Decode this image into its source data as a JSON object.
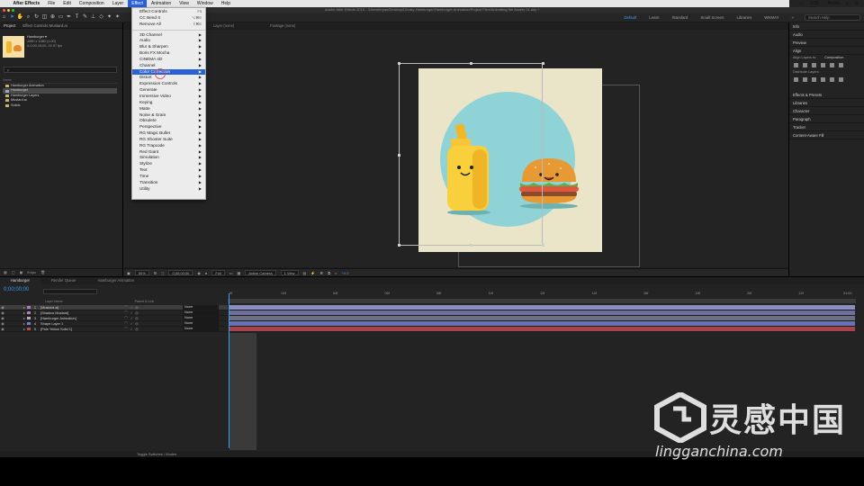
{
  "macbar": {
    "app": "After Effects",
    "menus": [
      "File",
      "Edit",
      "Composition",
      "Layer",
      "Effect",
      "Animation",
      "View",
      "Window",
      "Help"
    ],
    "active_menu": "Effect",
    "clock": "Tue 3:56 PM",
    "user": "Bryan"
  },
  "window": {
    "title": "Adobe After Effects 2019 - /Users/bryan/Desktop/Library-Hamburger/Hamburger Animation/Project Files/Animating the Assets 01.aep *"
  },
  "workspaces": {
    "items": [
      "Default",
      "Learn",
      "Standard",
      "Small Screen",
      "Libraries",
      "WKMAY"
    ],
    "active": "Default",
    "search_placeholder": "Search Help"
  },
  "project_panel": {
    "tabs": [
      "Project",
      "Effect Controls Mustard.ai"
    ],
    "item_name": "Hamburger ▾",
    "item_info_1": "1080 x 1080 (1.00)",
    "item_info_2": "Δ 0;00;15;00, 29.97 fps",
    "search_placeholder": "ρ",
    "column_name": "Name",
    "items": [
      {
        "name": "Hamburger Animation",
        "color": "#c9b36b"
      },
      {
        "name": "Hamburger",
        "color": "#9aa5c9"
      },
      {
        "name": "Hamburger Layers",
        "color": "#c9b36b"
      },
      {
        "name": "Mustard.ai",
        "color": "#c9b36b"
      },
      {
        "name": "Solids",
        "color": "#c9b36b"
      }
    ],
    "bpc": "8 bpc"
  },
  "comp_tabs": [
    "Layer (none)",
    "Footage (none)"
  ],
  "comp_footer": {
    "zoom": "50%",
    "timecode": "0;00;00;00",
    "resolution": "Full",
    "camera": "Active Camera",
    "views": "1 View",
    "exposure": "+0.0"
  },
  "effect_menu": {
    "items": [
      {
        "label": "Effect Controls",
        "shortcut": "F3"
      },
      {
        "label": "CC Bend It",
        "shortcut": "⌥⌘E"
      },
      {
        "label": "Remove All",
        "shortcut": "⇧⌘E"
      },
      {
        "sep": true
      },
      {
        "label": "3D Channel",
        "sub": true
      },
      {
        "label": "Audio",
        "sub": true
      },
      {
        "label": "Blur & Sharpen",
        "sub": true
      },
      {
        "label": "Boris FX Mocha",
        "sub": true
      },
      {
        "label": "CINEMA 4D",
        "sub": true
      },
      {
        "label": "Channel",
        "sub": true
      },
      {
        "label": "Color Correction",
        "sub": true,
        "hl": true
      },
      {
        "label": "Distort",
        "sub": true
      },
      {
        "label": "Expression Controls",
        "sub": true
      },
      {
        "label": "Generate",
        "sub": true
      },
      {
        "label": "Immersive Video",
        "sub": true
      },
      {
        "label": "Keying",
        "sub": true
      },
      {
        "label": "Matte",
        "sub": true
      },
      {
        "label": "Noise & Grain",
        "sub": true
      },
      {
        "label": "Obsolete",
        "sub": true
      },
      {
        "label": "Perspective",
        "sub": true
      },
      {
        "label": "RG Magic Bullet",
        "sub": true
      },
      {
        "label": "RG Shooter Suite",
        "sub": true
      },
      {
        "label": "RG Trapcode",
        "sub": true
      },
      {
        "label": "Red Giant",
        "sub": true
      },
      {
        "label": "Simulation",
        "sub": true
      },
      {
        "label": "Stylize",
        "sub": true
      },
      {
        "label": "Text",
        "sub": true
      },
      {
        "label": "Time",
        "sub": true
      },
      {
        "label": "Transition",
        "sub": true
      },
      {
        "label": "Utility",
        "sub": true
      }
    ]
  },
  "right_panel": {
    "sections": [
      "Info",
      "Audio",
      "Preview"
    ],
    "align_title": "Align",
    "align_to_label": "Align Layers to:",
    "align_to_value": "Composition",
    "distribute_label": "Distribute Layers:",
    "sections2": [
      "Effects & Presets",
      "Libraries",
      "Character",
      "Paragraph",
      "Tracker",
      "Content-Aware Fill"
    ]
  },
  "timeline": {
    "tabs": [
      "Hamburger",
      "Render Queue",
      "Hamburger Animation"
    ],
    "active_tab": "Hamburger",
    "timecode": "0;00;00;00",
    "col_layer_name": "Layer Name",
    "col_parent": "Parent & Link",
    "layers": [
      {
        "num": "1",
        "name": "[Mustard.ai]",
        "color": "#b07fbf",
        "parent": "None",
        "track": "#8a8fc0"
      },
      {
        "num": "2",
        "name": "[Shadow Mustard]",
        "color": "#b07fbf",
        "parent": "None",
        "track": "#6b6f99"
      },
      {
        "num": "3",
        "name": "[Hamburger Animation]",
        "color": "#b0b0b0",
        "parent": "None",
        "track": "#6c6e84"
      },
      {
        "num": "4",
        "name": "Shape Layer 1",
        "color": "#6f7fd1",
        "parent": "None",
        "track": "#6672b5"
      },
      {
        "num": "5",
        "name": "[Pale Yellow Solid 1]",
        "color": "#c04a4a",
        "parent": "None",
        "track": "#a8434b"
      }
    ],
    "ticks": [
      "0f",
      "02f",
      "04f",
      "06f",
      "08f",
      "10f",
      "12f",
      "14f",
      "16f",
      "18f",
      "20f",
      "22f",
      "01:00"
    ],
    "footer": "Toggle Switches / Modes"
  },
  "watermark": {
    "cn": "灵感中国",
    "url": "lingganchina.com"
  }
}
